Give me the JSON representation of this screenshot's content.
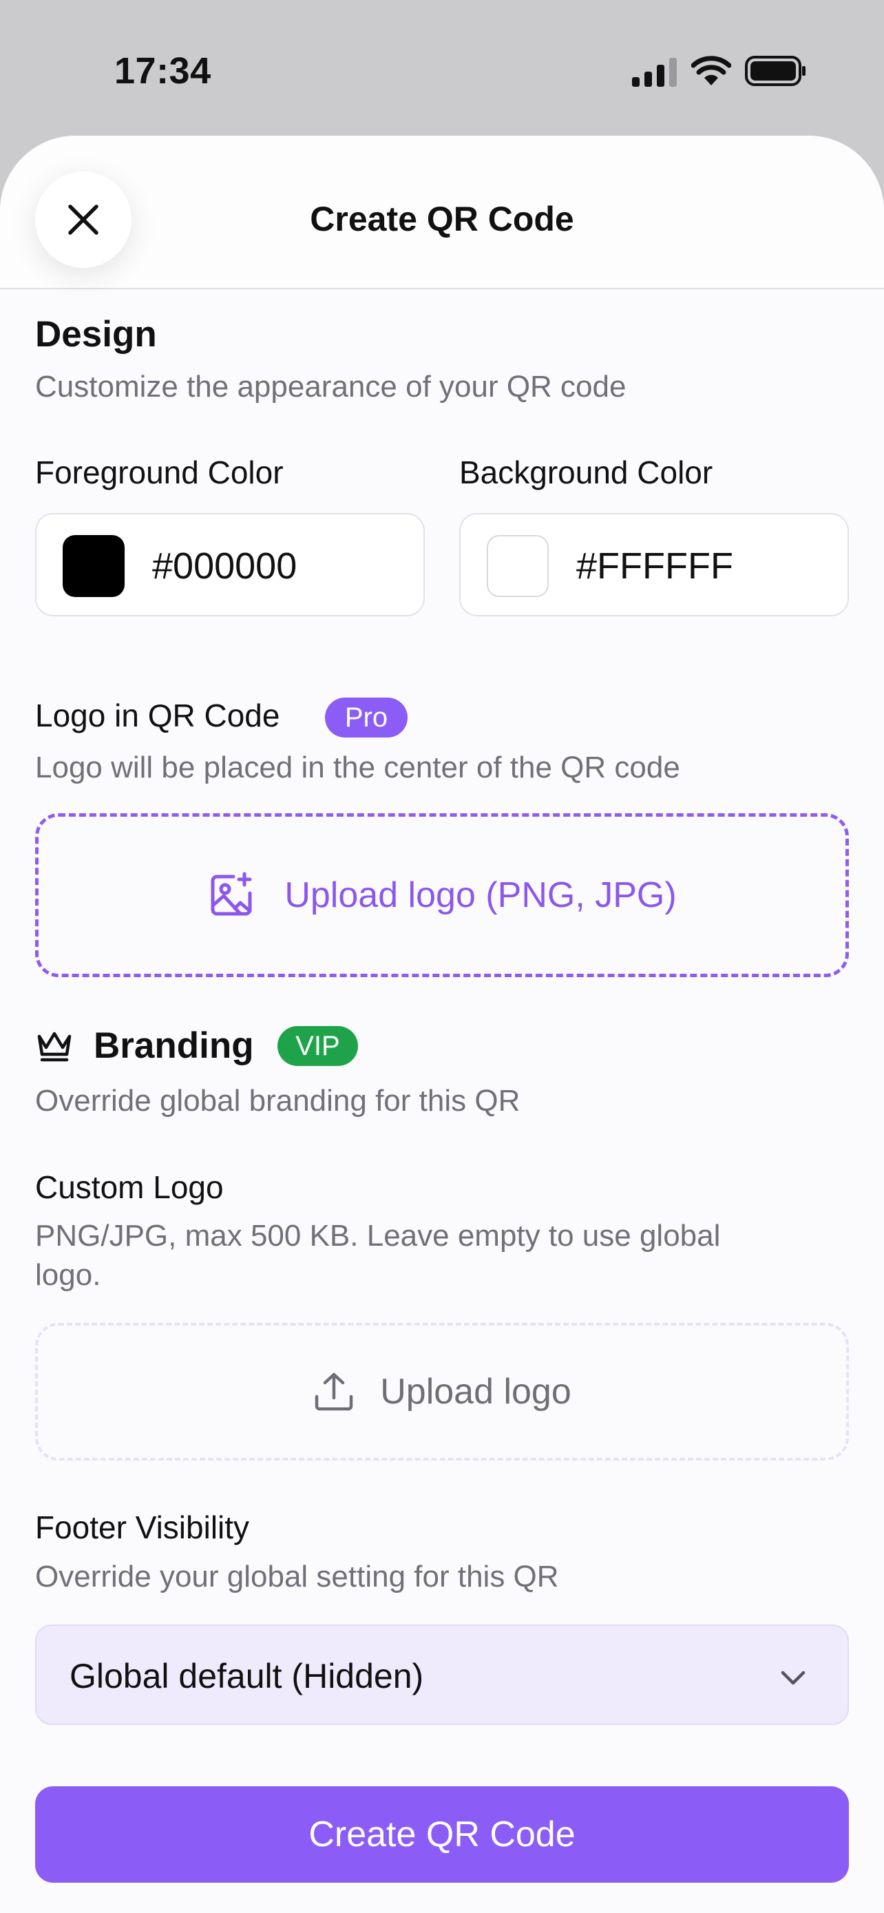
{
  "status_bar": {
    "time": "17:34"
  },
  "header": {
    "title": "Create QR Code"
  },
  "design": {
    "title": "Design",
    "description": "Customize the appearance of your QR code",
    "foreground": {
      "label": "Foreground Color",
      "value": "#000000",
      "swatch_color": "#000000"
    },
    "background": {
      "label": "Background Color",
      "value": "#FFFFFF",
      "swatch_color": "#FFFFFF"
    }
  },
  "logo": {
    "title": "Logo in QR Code",
    "badge": "Pro",
    "badge_color": "#8b5cf6",
    "description": "Logo will be placed in the center of the QR code",
    "upload_label": "Upload logo (PNG, JPG)",
    "icon": "image-plus-icon"
  },
  "branding": {
    "title": "Branding",
    "icon": "crown-icon",
    "badge": "VIP",
    "badge_color": "#1fa34a",
    "description": "Override global branding for this QR",
    "custom_logo": {
      "label": "Custom Logo",
      "help_line1": "PNG/JPG, max 500 KB. Leave empty to use global",
      "help_line2": "logo.",
      "upload_label": "Upload logo",
      "icon": "upload-icon"
    },
    "footer": {
      "label": "Footer Visibility",
      "description": "Override your global setting for this QR",
      "selected": "Global default (Hidden)"
    }
  },
  "actions": {
    "create_label": "Create QR Code",
    "accent_color": "#8b5cf6"
  }
}
